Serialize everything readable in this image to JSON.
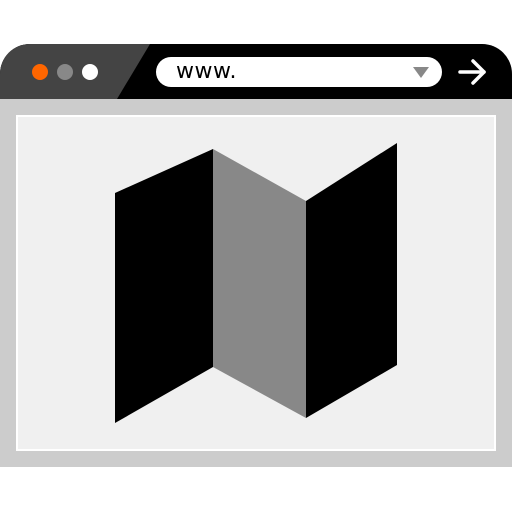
{
  "colors": {
    "titlebar": "#000000",
    "tab": "#444444",
    "frame": "#cccccc",
    "content": "#f0f0f0",
    "dot_close": "#ff6600",
    "dot_minimize": "#888888",
    "dot_maximize": "#ffffff",
    "map_dark": "#000000",
    "map_fold": "#888888"
  },
  "window_controls": [
    {
      "name": "close-dot",
      "color": "#ff6600"
    },
    {
      "name": "minimize-dot",
      "color": "#888888"
    },
    {
      "name": "maximize-dot",
      "color": "#ffffff"
    }
  ],
  "address_bar": {
    "text": "www."
  },
  "icons": {
    "dropdown": "chevron-down-icon",
    "go": "arrow-right-icon",
    "content": "folded-map-icon"
  }
}
